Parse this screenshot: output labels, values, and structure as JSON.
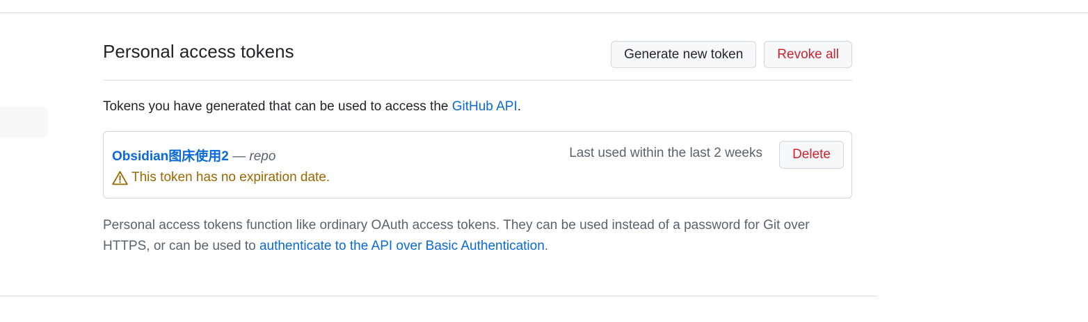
{
  "header": {
    "title": "Personal access tokens",
    "generate_label": "Generate new token",
    "revoke_label": "Revoke all"
  },
  "intro": {
    "text": "Tokens you have generated that can be used to access the ",
    "link": "GitHub API",
    "suffix": "."
  },
  "tokens": [
    {
      "name": "Obsidian图床使用2",
      "scope": " — repo",
      "last_used": "Last used within the last 2 weeks",
      "warning": "This token has no expiration date.",
      "delete_label": "Delete"
    }
  ],
  "footnote": {
    "text": "Personal access tokens function like ordinary OAuth access tokens. They can be used instead of a password for Git over HTTPS, or can be used to ",
    "link": "authenticate to the API over Basic Authentication",
    "suffix": "."
  },
  "colors": {
    "link": "#0969da",
    "danger": "#cf222e",
    "warning": "#9a6700",
    "muted": "#59636e"
  },
  "icons": {
    "warning": "alert-triangle-icon"
  }
}
